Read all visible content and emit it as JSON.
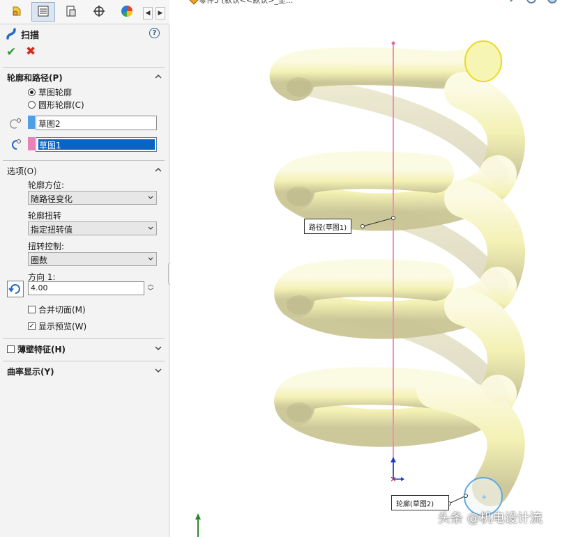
{
  "feature": {
    "title": "扫描"
  },
  "sections": {
    "profile_path": {
      "title": "轮廓和路径(P)",
      "radio_sketch": "草图轮廓",
      "radio_circle": "圆形轮廓(C)",
      "profile_value": "草图2",
      "path_value": "草图1"
    },
    "options": {
      "title": "选项(O)",
      "orientation_label": "轮廓方位:",
      "orientation_value": "随路径变化",
      "twist_label": "轮廓扭转",
      "twist_value": "指定扭转值",
      "twist_control_label": "扭转控制:",
      "twist_control_value": "圈数",
      "direction_label": "方向 1:",
      "direction_value": "4.00",
      "merge_faces": "合并切面(M)",
      "show_preview": "显示预览(W)"
    },
    "thin_feature": {
      "title": "薄壁特征(H)"
    },
    "curvature": {
      "title": "曲率显示(Y)"
    }
  },
  "graphics": {
    "document_title": "零件5 (默认<<默认>_显...",
    "path_callout": "路径(草图1)",
    "profile_callout": "轮廓(草图2)",
    "watermark": "头条 @机电设计流"
  },
  "colors": {
    "profile_swatch": "#4f9ee8",
    "path_swatch": "#e982b7",
    "spring": "#f6f3b4",
    "axis_line": "#f08fb8"
  },
  "state": {
    "twist_turns": 4.0,
    "radio_selected": "sketch_profile",
    "merge_faces_checked": false,
    "show_preview_checked": true,
    "thin_feature_checked": false
  }
}
